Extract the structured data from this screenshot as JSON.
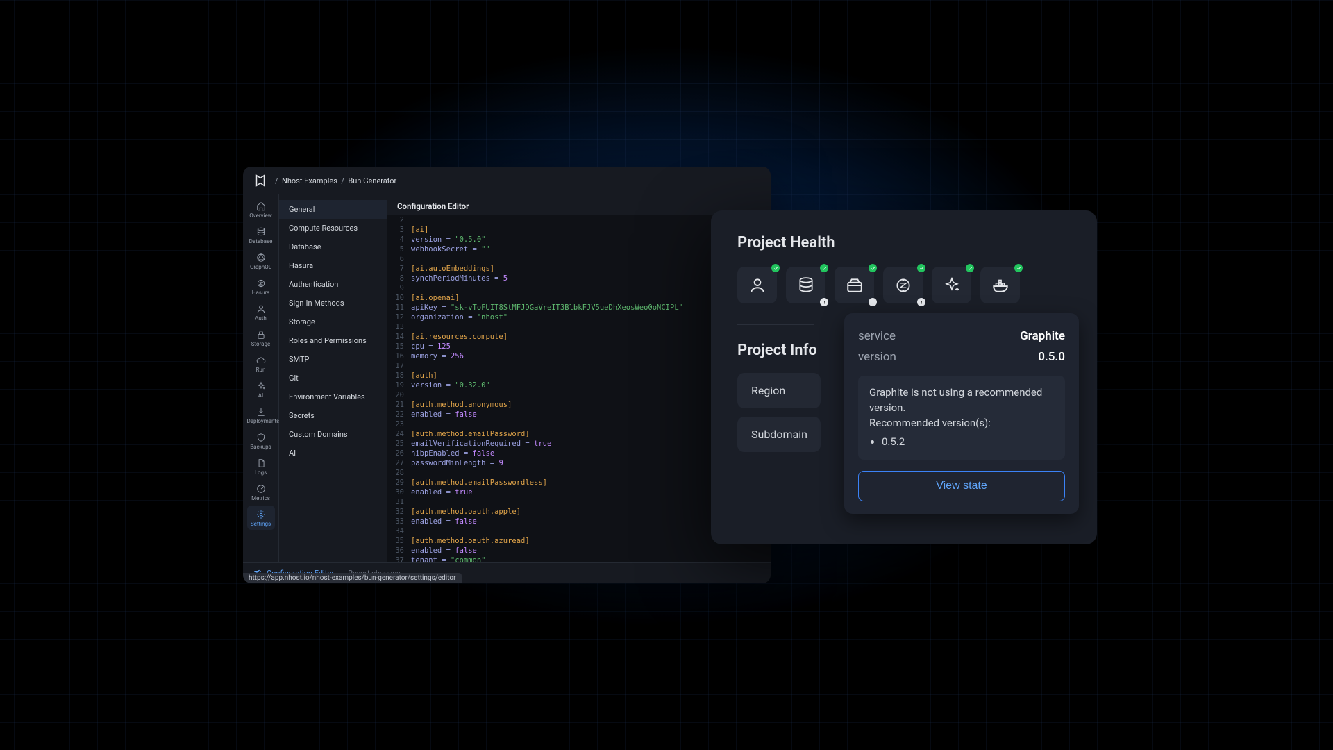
{
  "breadcrumb": {
    "org": "Nhost Examples",
    "project": "Bun Generator"
  },
  "rail": [
    {
      "label": "Overview",
      "icon": "home"
    },
    {
      "label": "Database",
      "icon": "database"
    },
    {
      "label": "GraphQL",
      "icon": "graphql"
    },
    {
      "label": "Hasura",
      "icon": "hasura"
    },
    {
      "label": "Auth",
      "icon": "user"
    },
    {
      "label": "Storage",
      "icon": "lock"
    },
    {
      "label": "Run",
      "icon": "cloud"
    },
    {
      "label": "AI",
      "icon": "sparkles"
    },
    {
      "label": "Deployments",
      "icon": "deploy"
    },
    {
      "label": "Backups",
      "icon": "shield"
    },
    {
      "label": "Logs",
      "icon": "file"
    },
    {
      "label": "Metrics",
      "icon": "gauge"
    },
    {
      "label": "Settings",
      "icon": "gear",
      "active": true
    }
  ],
  "settings_menu": [
    "General",
    "Compute Resources",
    "Database",
    "Hasura",
    "Authentication",
    "Sign-In Methods",
    "Storage",
    "Roles and Permissions",
    "SMTP",
    "Git",
    "Environment Variables",
    "Secrets",
    "Custom Domains",
    "AI"
  ],
  "editor": {
    "title": "Configuration Editor",
    "lines": [
      {
        "n": 2,
        "raw": ""
      },
      {
        "n": 3,
        "section": "[ai]"
      },
      {
        "n": 4,
        "k": "version",
        "str": "\"0.5.0\""
      },
      {
        "n": 5,
        "k": "webhookSecret",
        "str": "\"\""
      },
      {
        "n": 6,
        "raw": ""
      },
      {
        "n": 7,
        "section": "[ai.autoEmbeddings]"
      },
      {
        "n": 8,
        "k": "synchPeriodMinutes",
        "num": "5"
      },
      {
        "n": 9,
        "raw": ""
      },
      {
        "n": 10,
        "section": "[ai.openai]"
      },
      {
        "n": 11,
        "k": "apiKey",
        "str": "\"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\""
      },
      {
        "n": 12,
        "k": "organization",
        "str": "\"nhost\""
      },
      {
        "n": 13,
        "raw": ""
      },
      {
        "n": 14,
        "section": "[ai.resources.compute]"
      },
      {
        "n": 15,
        "k": "cpu",
        "num": "125"
      },
      {
        "n": 16,
        "k": "memory",
        "num": "256"
      },
      {
        "n": 17,
        "raw": ""
      },
      {
        "n": 18,
        "section": "[auth]"
      },
      {
        "n": 19,
        "k": "version",
        "str": "\"0.32.0\""
      },
      {
        "n": 20,
        "raw": ""
      },
      {
        "n": 21,
        "section": "[auth.method.anonymous]"
      },
      {
        "n": 22,
        "k": "enabled",
        "bool": "false"
      },
      {
        "n": 23,
        "raw": ""
      },
      {
        "n": 24,
        "section": "[auth.method.emailPassword]"
      },
      {
        "n": 25,
        "k": "emailVerificationRequired",
        "bool": "true"
      },
      {
        "n": 26,
        "k": "hibpEnabled",
        "bool": "false"
      },
      {
        "n": 27,
        "k": "passwordMinLength",
        "num": "9"
      },
      {
        "n": 28,
        "raw": ""
      },
      {
        "n": 29,
        "section": "[auth.method.emailPasswordless]"
      },
      {
        "n": 30,
        "k": "enabled",
        "bool": "true"
      },
      {
        "n": 31,
        "raw": ""
      },
      {
        "n": 32,
        "section": "[auth.method.oauth.apple]"
      },
      {
        "n": 33,
        "k": "enabled",
        "bool": "false"
      },
      {
        "n": 34,
        "raw": ""
      },
      {
        "n": 35,
        "section": "[auth.method.oauth.azuread]"
      },
      {
        "n": 36,
        "k": "enabled",
        "bool": "false"
      },
      {
        "n": 37,
        "k": "tenant",
        "str": "\"common\""
      }
    ]
  },
  "bottom": {
    "config_link": "Configuration Editor",
    "revert": "Revert changes",
    "url_hint": "https://app.nhost.io/nhost-examples/bun-generator/settings/editor"
  },
  "health": {
    "title": "Project Health",
    "icons": [
      {
        "name": "user",
        "ok": true,
        "warn": false
      },
      {
        "name": "database",
        "ok": true,
        "warn": true
      },
      {
        "name": "storage",
        "ok": true,
        "warn": true
      },
      {
        "name": "hasura",
        "ok": true,
        "warn": true
      },
      {
        "name": "sparkles",
        "ok": true,
        "warn": false
      },
      {
        "name": "docker",
        "ok": true,
        "warn": false
      }
    ],
    "info_title": "Project Info",
    "rows": [
      "Region",
      "Subdomain"
    ]
  },
  "tooltip": {
    "service_label": "service",
    "service_value": "Graphite",
    "version_label": "version",
    "version_value": "0.5.0",
    "msg_line1": "Graphite is not using a recommended version.",
    "msg_line2": "Recommended version(s):",
    "recommended": "0.5.2",
    "button": "View state"
  }
}
